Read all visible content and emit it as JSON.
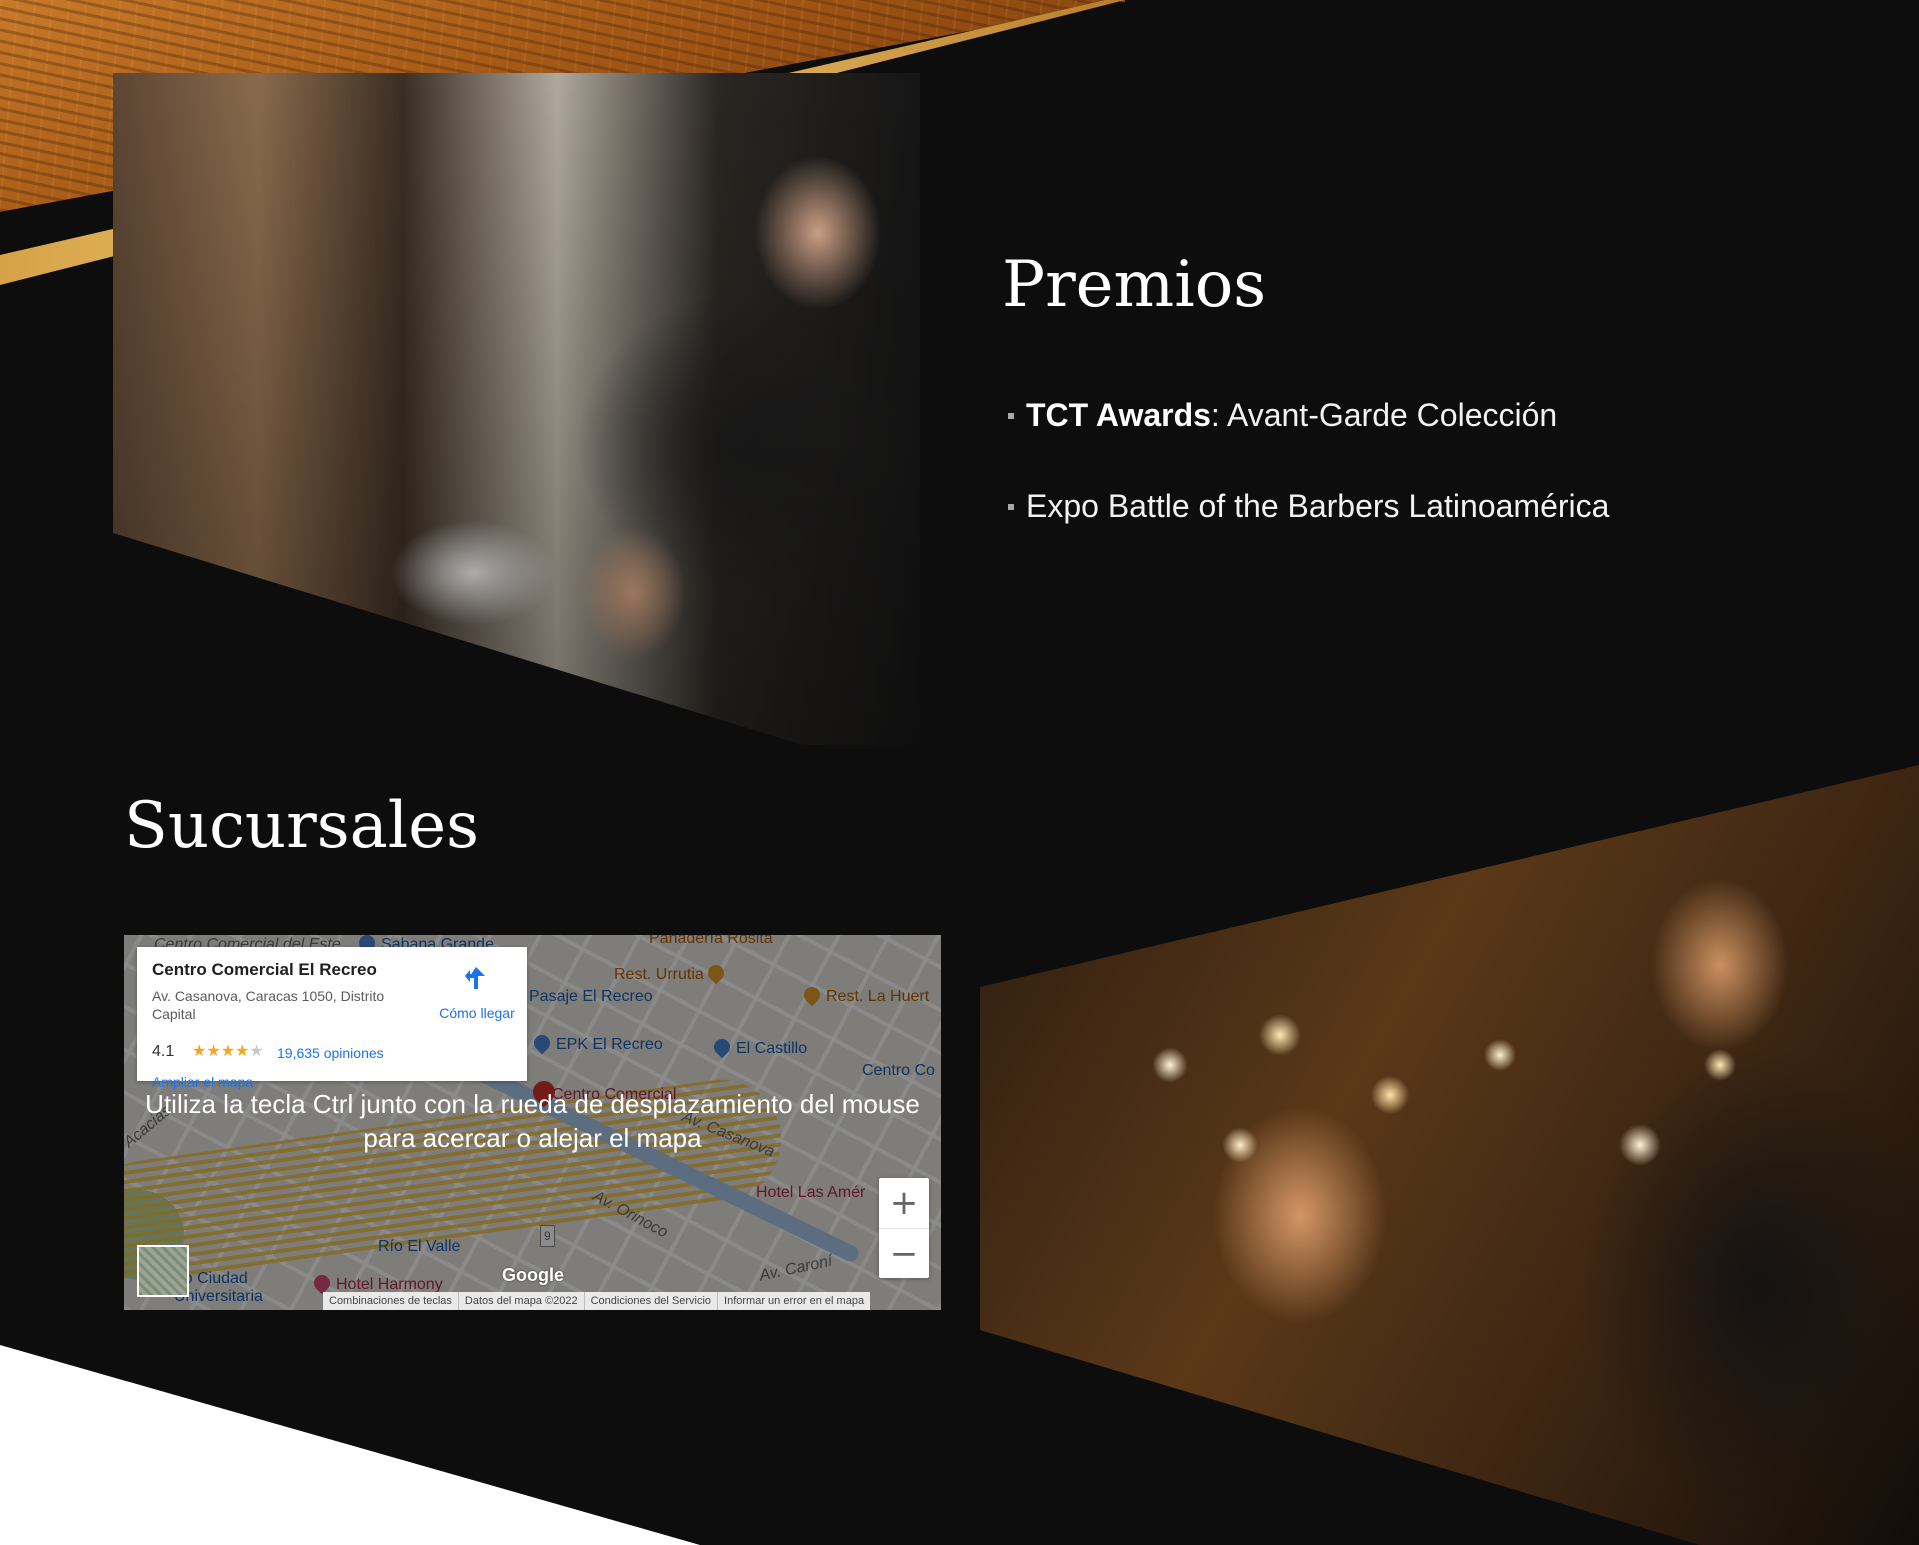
{
  "premios": {
    "title": "Premios",
    "awards": [
      {
        "strong": "TCT Awards",
        "rest": ": Avant-Garde Colección"
      },
      {
        "strong": "",
        "rest": "Expo Battle of the Barbers Latinoamérica"
      }
    ]
  },
  "sucursales": {
    "title": "Sucursales"
  },
  "map": {
    "card": {
      "title": "Centro Comercial El Recreo",
      "address": "Av. Casanova, Caracas 1050, Distrito Capital",
      "rating": "4.1",
      "stars_filled": "★★★★",
      "stars_empty": "★",
      "reviews": "19,635 opiniones",
      "enlarge": "Ampliar el mapa",
      "directions": "Cómo llegar"
    },
    "overlay_text": "Utiliza la tecla Ctrl junto con la rueda de desplazamiento del mouse para acercar o alejar el mapa",
    "zoom_in": "+",
    "zoom_out": "−",
    "google_logo": "Google",
    "footer": [
      "Combinaciones de teclas",
      "Datos del mapa ©2022",
      "Condiciones del Servicio",
      "Informar un error en el mapa"
    ],
    "labels": {
      "cc_del_este": "Centro Comercial del Este",
      "sabana_grande": "Sabana Grande",
      "panaderia": "Panadería Rosita",
      "rest_urrutia": "Rest. Urrutia",
      "rest_la_huerta": "Rest. La Huert",
      "pasaje": "Pasaje El Recreo",
      "epk": "EPK El Recreo",
      "castillo": "El Castillo",
      "centro_co": "Centro Co",
      "centro_comercial": "Centro Comercial",
      "casanova": "Av. Casanova",
      "acacias": "Acacias",
      "orinoco": "Av. Orinoco",
      "hotel_las_amer": "Hotel Las Amér",
      "rio_el_valle": "Río El Valle",
      "ciudad_univ": "tro Ciudad\nUniversitaria",
      "hotel_harmony": "Hotel Harmony",
      "av_caroni": "Av. Caroní",
      "route_9": "9"
    }
  },
  "colors": {
    "background": "#0d0d0d",
    "gold": "#d6a248",
    "link_blue": "#1a73e8",
    "star": "#f5a623"
  }
}
